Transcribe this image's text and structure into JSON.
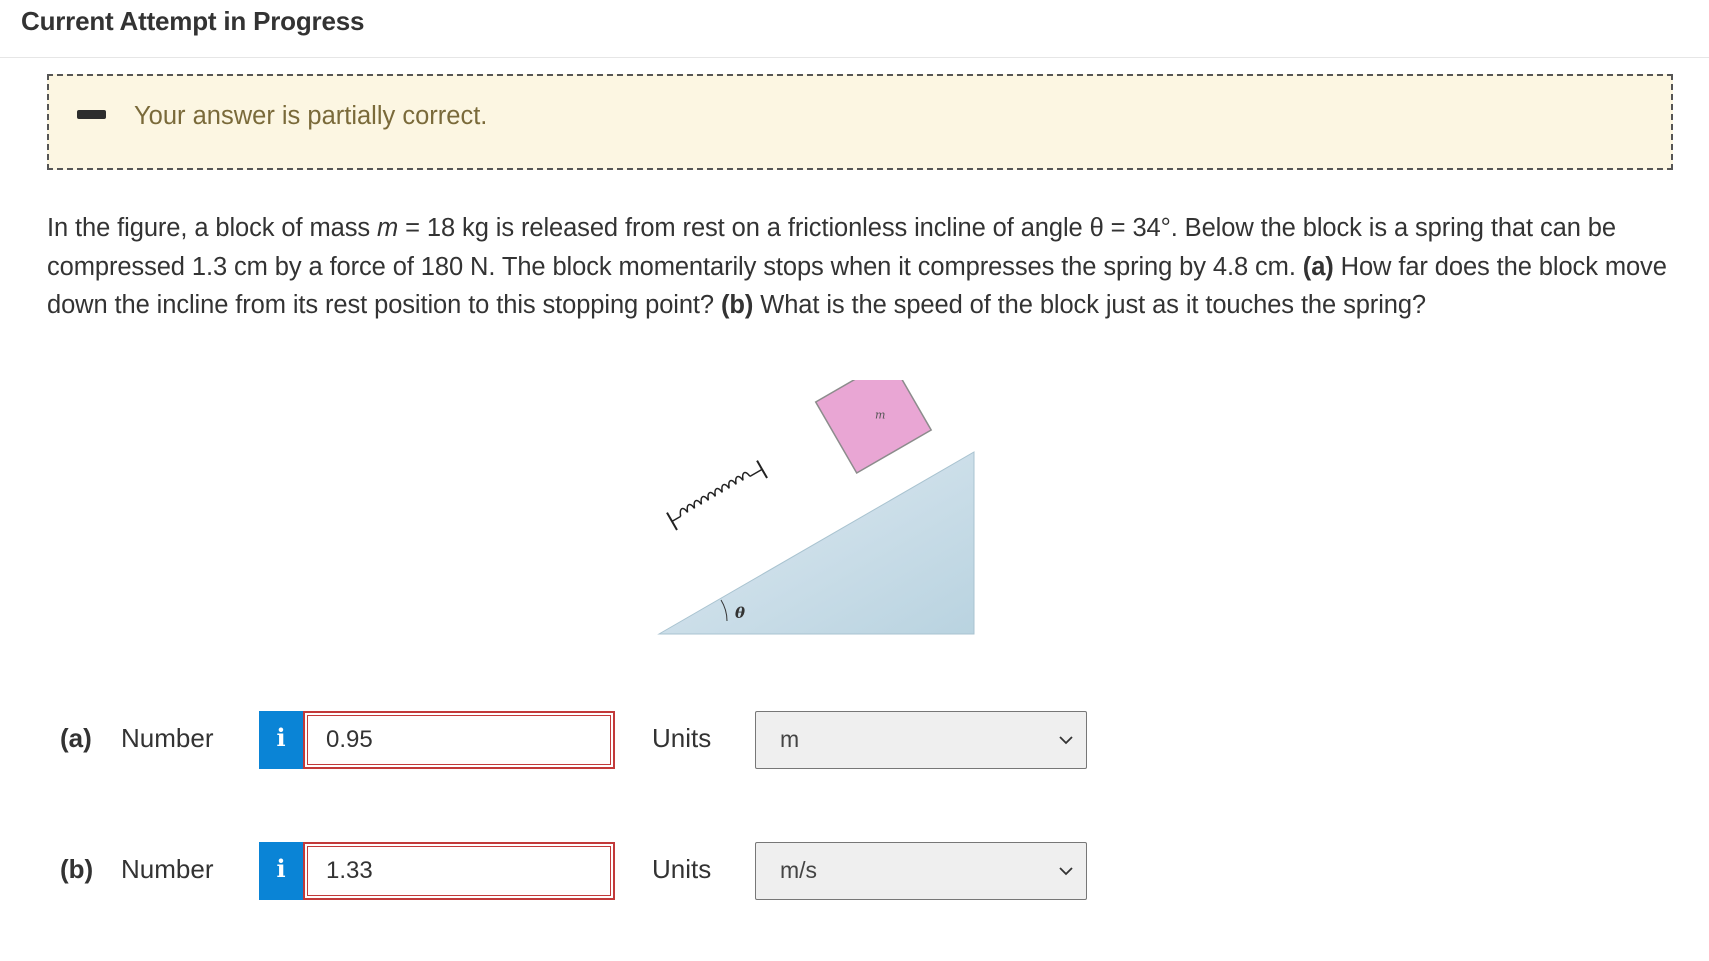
{
  "header": {
    "title": "Current Attempt in Progress"
  },
  "feedback": {
    "text": "Your answer is partially correct."
  },
  "problem": {
    "intro": "In the figure, a block of mass ",
    "mass_var": "m",
    "mass_value": " = 18 kg is released from rest on a frictionless incline of angle θ = 34°. Below the block is a spring that can be compressed 1.3 cm by a force of 180 N. The block momentarily stops when it compresses the spring by 4.8 cm. ",
    "part_a_tag": "(a)",
    "part_a_question": " How far does the block move down the incline from its rest position to this stopping point? ",
    "part_b_tag": "(b)",
    "part_b_question": " What is the speed of the block just as it touches the spring?"
  },
  "figure": {
    "block_label": "m",
    "angle_label": "θ"
  },
  "answers": [
    {
      "part": "(a)",
      "number_label": "Number",
      "info_label": "i",
      "value": "0.95",
      "units_label": "Units",
      "unit": "m"
    },
    {
      "part": "(b)",
      "number_label": "Number",
      "info_label": "i",
      "value": "1.33",
      "units_label": "Units",
      "unit": "m/s"
    }
  ],
  "colors": {
    "feedback_bg": "#fcf6e2",
    "info_button": "#0a84d6",
    "incorrect_border": "#c23a3a",
    "block": "#e9a6d4"
  }
}
